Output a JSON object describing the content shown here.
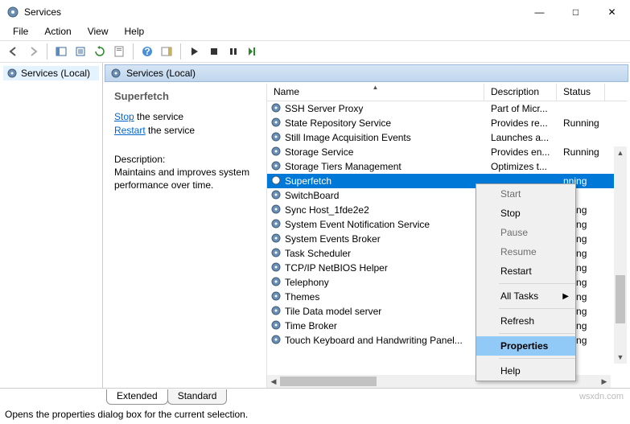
{
  "title": "Services",
  "menubar": {
    "file": "File",
    "action": "Action",
    "view": "View",
    "help": "Help"
  },
  "left_pane": {
    "item": "Services (Local)"
  },
  "right_header": "Services (Local)",
  "detail": {
    "heading": "Superfetch",
    "stop_link": "Stop",
    "stop_rest": " the service",
    "restart_link": "Restart",
    "restart_rest": " the service",
    "desc_label": "Description:",
    "desc_text": "Maintains and improves system performance over time."
  },
  "columns": {
    "name": "Name",
    "desc": "Description",
    "status": "Status"
  },
  "rows": [
    {
      "name": "SSH Server Proxy",
      "desc": "Part of Micr...",
      "status": ""
    },
    {
      "name": "State Repository Service",
      "desc": "Provides re...",
      "status": "Running"
    },
    {
      "name": "Still Image Acquisition Events",
      "desc": "Launches a...",
      "status": ""
    },
    {
      "name": "Storage Service",
      "desc": "Provides en...",
      "status": "Running"
    },
    {
      "name": "Storage Tiers Management",
      "desc": "Optimizes t...",
      "status": ""
    },
    {
      "name": "Superfetch",
      "desc": "",
      "status": "nning",
      "selected": true
    },
    {
      "name": "SwitchBoard",
      "desc": "",
      "status": ""
    },
    {
      "name": "Sync Host_1fde2e2",
      "desc": "",
      "status": "nning"
    },
    {
      "name": "System Event Notification Service",
      "desc": "",
      "status": "nning"
    },
    {
      "name": "System Events Broker",
      "desc": "",
      "status": "nning"
    },
    {
      "name": "Task Scheduler",
      "desc": "",
      "status": "nning"
    },
    {
      "name": "TCP/IP NetBIOS Helper",
      "desc": "",
      "status": "nning"
    },
    {
      "name": "Telephony",
      "desc": "",
      "status": "nning"
    },
    {
      "name": "Themes",
      "desc": "",
      "status": "nning"
    },
    {
      "name": "Tile Data model server",
      "desc": "",
      "status": "nning"
    },
    {
      "name": "Time Broker",
      "desc": "",
      "status": "nning"
    },
    {
      "name": "Touch Keyboard and Handwriting Panel...",
      "desc": "",
      "status": "nning"
    }
  ],
  "context_menu": {
    "start": "Start",
    "stop": "Stop",
    "pause": "Pause",
    "resume": "Resume",
    "restart": "Restart",
    "all_tasks": "All Tasks",
    "refresh": "Refresh",
    "properties": "Properties",
    "help": "Help"
  },
  "tabs": {
    "extended": "Extended",
    "standard": "Standard"
  },
  "statusbar": "Opens the properties dialog box for the current selection.",
  "watermark": "wsxdn.com"
}
